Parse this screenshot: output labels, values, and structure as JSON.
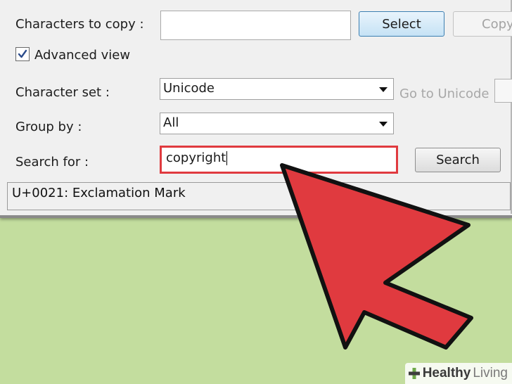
{
  "form": {
    "characters_label": "Characters to copy :",
    "characters_value": "",
    "select_button": "Select",
    "copy_button": "Copy",
    "advanced_view_label": "Advanced view",
    "advanced_view_checked": true,
    "charset_label": "Character set :",
    "charset_value": "Unicode",
    "goto_unicode_label": "Go to Unicode :",
    "groupby_label": "Group by :",
    "groupby_value": "All",
    "searchfor_label": "Search for :",
    "search_value": "copyright",
    "search_button": "Search"
  },
  "status_bar": {
    "text": "U+0021: Exclamation Mark"
  },
  "watermark": {
    "part1": "Healthy",
    "part2": "Living"
  },
  "colors": {
    "background": "#c3dd9e",
    "highlight": "#e03a3f",
    "cursor_fill": "#e03a3f"
  }
}
